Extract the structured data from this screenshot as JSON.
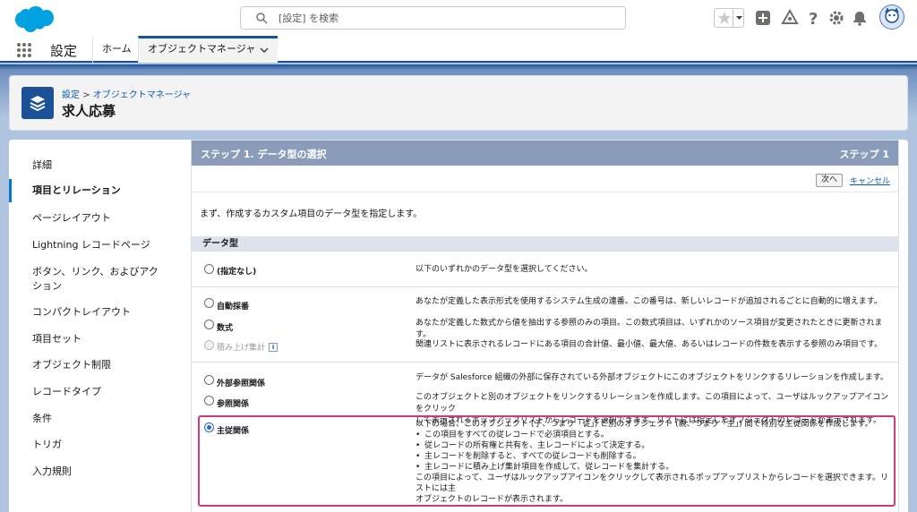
{
  "topbar": {
    "search_placeholder": "[設定] を検索"
  },
  "navbar": {
    "app_name": "設定",
    "tabs": [
      {
        "label": "ホーム"
      },
      {
        "label": "オブジェクトマネージャ"
      }
    ]
  },
  "header": {
    "breadcrumb_root": "設定",
    "breadcrumb_sep": ">",
    "breadcrumb_current": "オブジェクトマネージャ",
    "title": "求人応募"
  },
  "sidebar": {
    "items": [
      {
        "label": "詳細"
      },
      {
        "label": "項目とリレーション"
      },
      {
        "label": "ページレイアウト"
      },
      {
        "label": "Lightning レコードページ"
      },
      {
        "label": "ボタン、リンク、およびアクション"
      },
      {
        "label": "コンパクトレイアウト"
      },
      {
        "label": "項目セット"
      },
      {
        "label": "オブジェクト制限"
      },
      {
        "label": "レコードタイプ"
      },
      {
        "label": "条件"
      },
      {
        "label": "トリガ"
      },
      {
        "label": "入力規則"
      }
    ]
  },
  "main": {
    "step_title": "ステップ 1. データ型の選択",
    "step_label": "ステップ 1",
    "next_label": "次へ",
    "cancel_label": "キャンセル",
    "intro": "まず、作成するカスタム項目のデータ型を指定します。",
    "section_title": "データ型",
    "options": [
      {
        "label": "(指定なし)",
        "desc": "以下のいずれかのデータ型を選択してください。"
      },
      {
        "label": "自動採番",
        "desc": "あなたが定義した表示形式を使用するシステム生成の連番。この番号は、新しいレコードが追加されるごとに自動的に増えます。"
      },
      {
        "label": "数式",
        "desc": "あなたが定義した数式から値を抽出する参照のみの項目。この数式項目は、いずれかのソース項目が変更されたときに更新されます。"
      },
      {
        "label": "積み上げ集計",
        "desc": "関連リストに表示されるレコードにある項目の合計値、最小値、最大値、あるいはレコードの件数を表示する参照のみ項目です。"
      },
      {
        "label": "外部参照関係",
        "desc": "データが Salesforce 組織の外部に保存されている外部オブジェクトにこのオブジェクトをリンクするリレーションを作成します。"
      },
      {
        "label": "参照関係",
        "desc_line1": "このオブジェクトと別のオブジェクトをリンクするリレーションを作成します。この項目によって、ユーザはルックアップアイコンをクリック",
        "desc_line2": "して表示されるポップアップリストからレコードを選択できます。リストには指定したオブジェクトのレコードが表示されます。"
      },
      {
        "label": "主従関係",
        "desc_intro": "以下の場合、このオブジェクト (子、つまり「従」) と別のオブジェクト (親、つまり「主」) 間で特別な主従関係を作成します。",
        "bullets": [
          "この項目をすべての従レコードで必須項目とする。",
          "従レコードの所有権と共有を、主レコードによって決定する。",
          "主レコードを削除すると、すべての従レコードも削除する。",
          "主レコードに積み上げ集計項目を作成して、従レコードを集計する。"
        ],
        "desc_outro_line1": "この項目によって、ユーザはルックアップアイコンをクリックして表示されるポップアップリストからレコードを選択できます。リストには主",
        "desc_outro_line2": "オブジェクトのレコードが表示されます。"
      }
    ]
  },
  "colors": {
    "brand": "#1b5297",
    "step_bar": "#8a9cba",
    "link": "#0b5cab",
    "highlight": "#d13a7a"
  }
}
